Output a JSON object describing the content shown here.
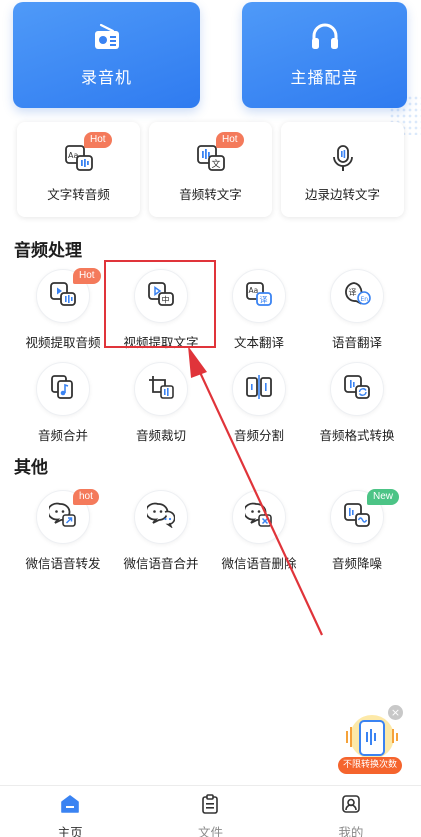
{
  "top_cards": [
    {
      "label": "录音机",
      "icon": "radio-icon"
    },
    {
      "label": "主播配音",
      "icon": "headphones-icon"
    }
  ],
  "mid_cards": [
    {
      "label": "文字转音频",
      "badge": "Hot",
      "icon": "text-to-audio-icon"
    },
    {
      "label": "音频转文字",
      "badge": "Hot",
      "icon": "audio-to-text-icon"
    },
    {
      "label": "边录边转文字",
      "badge": "",
      "icon": "microphone-icon"
    }
  ],
  "audio_section": {
    "title": "音频处理",
    "tools": [
      {
        "label": "视频提取音频",
        "badge": "Hot",
        "icon": "video-extract-audio-icon"
      },
      {
        "label": "视频提取文字",
        "badge": "",
        "icon": "video-extract-text-icon"
      },
      {
        "label": "文本翻译",
        "badge": "",
        "icon": "text-translate-icon"
      },
      {
        "label": "语音翻译",
        "badge": "",
        "icon": "voice-translate-icon"
      },
      {
        "label": "音频合并",
        "badge": "",
        "icon": "audio-merge-icon"
      },
      {
        "label": "音频裁切",
        "badge": "",
        "icon": "audio-crop-icon"
      },
      {
        "label": "音频分割",
        "badge": "",
        "icon": "audio-split-icon"
      },
      {
        "label": "音频格式转换",
        "badge": "",
        "icon": "audio-format-icon"
      }
    ]
  },
  "other_section": {
    "title": "其他",
    "tools": [
      {
        "label": "微信语音转发",
        "badge": "hot",
        "icon": "wechat-forward-icon"
      },
      {
        "label": "微信语音合并",
        "badge": "",
        "icon": "wechat-merge-icon"
      },
      {
        "label": "微信语音删除",
        "badge": "",
        "icon": "wechat-delete-icon"
      },
      {
        "label": "音频降噪",
        "badge": "New",
        "icon": "noise-reduction-icon"
      }
    ]
  },
  "floating": {
    "tag": "不限转换次数"
  },
  "tabbar": [
    {
      "label": "主页",
      "active": true,
      "icon": "home-icon"
    },
    {
      "label": "文件",
      "active": false,
      "icon": "clipboard-icon"
    },
    {
      "label": "我的",
      "active": false,
      "icon": "profile-icon"
    }
  ],
  "colors": {
    "primary": "#2f7bf0",
    "hot_badge": "#f47a5b",
    "new_badge": "#4cc486",
    "highlight": "#e0343a",
    "arrow": "#e0343a",
    "float_tag": "#f5642d"
  }
}
